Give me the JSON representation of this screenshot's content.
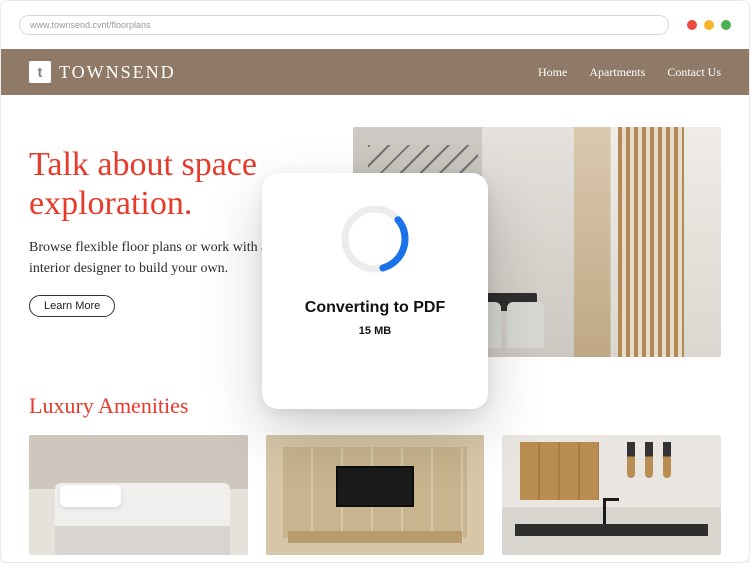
{
  "browser": {
    "url": "www.townsend.cvnt/floorplans"
  },
  "brand": {
    "mark": "t",
    "name": "TOWNSEND"
  },
  "nav": {
    "home": "Home",
    "apartments": "Apartments",
    "contact": "Contact Us"
  },
  "hero": {
    "title_l1": "Talk about space",
    "title_l2": "exploration.",
    "subtitle": "Browse flexible floor plans or work with an interior designer to build your own.",
    "cta": "Learn More"
  },
  "section": {
    "amenities_title": "Luxury Amenities"
  },
  "modal": {
    "title": "Converting to PDF",
    "size": "15 MB"
  },
  "colors": {
    "accent": "#e63a2b",
    "header": "#8f7a68",
    "spinner": "#1a73e8"
  }
}
